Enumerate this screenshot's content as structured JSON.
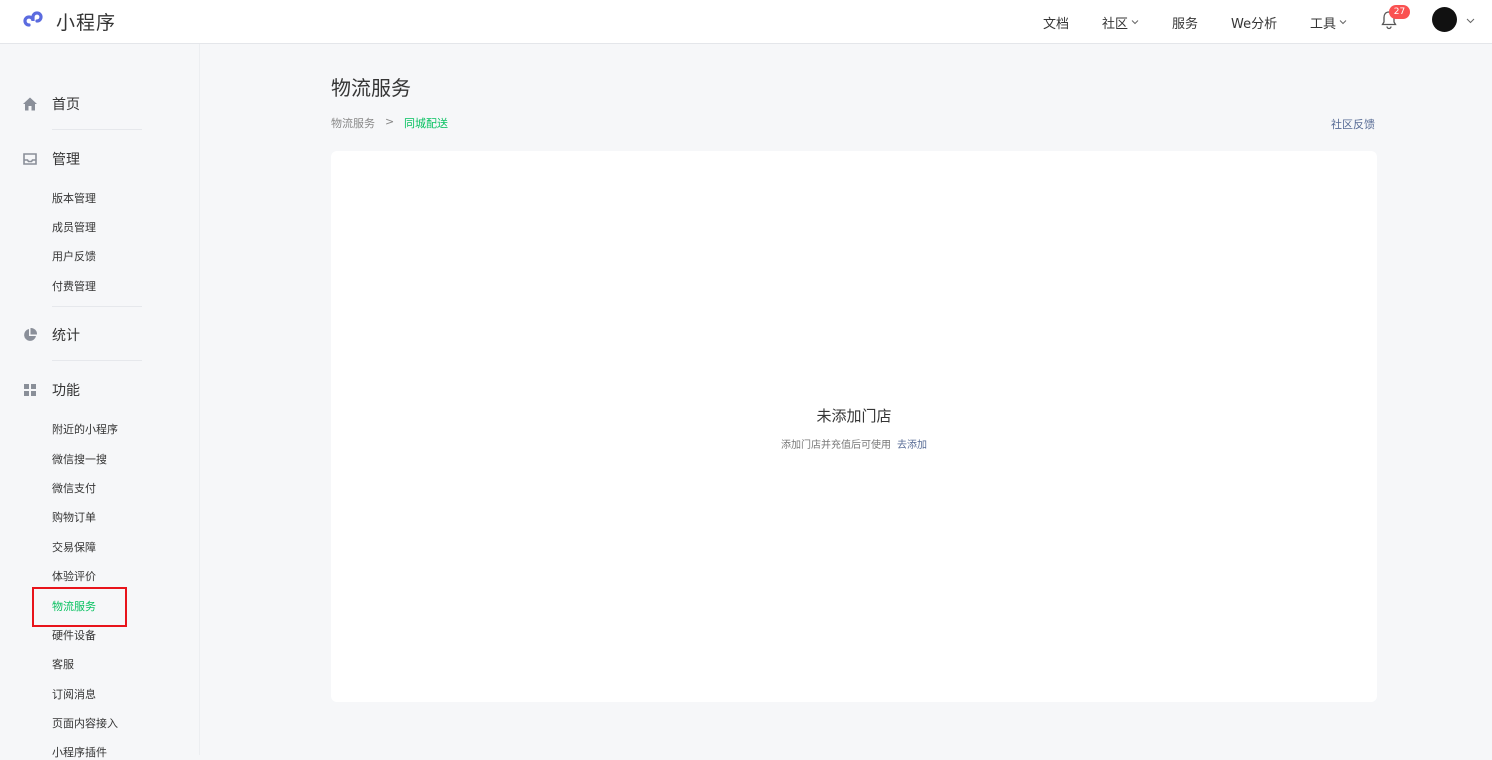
{
  "header": {
    "logo_text": "小程序",
    "nav": {
      "docs": "文档",
      "community": "社区",
      "services": "服务",
      "we_analytics": "We分析",
      "tools": "工具"
    },
    "notification_count": "27"
  },
  "sidebar": {
    "home": "首页",
    "manage": "管理",
    "manage_items": [
      "版本管理",
      "成员管理",
      "用户反馈",
      "付费管理"
    ],
    "stats": "统计",
    "features": "功能",
    "feature_items": [
      "附近的小程序",
      "微信搜一搜",
      "微信支付",
      "购物订单",
      "交易保障",
      "体验评价",
      "物流服务",
      "硬件设备",
      "客服",
      "订阅消息",
      "页面内容接入",
      "小程序插件"
    ]
  },
  "main": {
    "title": "物流服务",
    "breadcrumb": [
      "物流服务",
      "同城配送"
    ],
    "breadcrumb_sep": ">",
    "feedback_link": "社区反馈",
    "empty_title": "未添加门店",
    "empty_desc": "添加门店并充值后可使用",
    "empty_action": "去添加"
  },
  "colors": {
    "accent_green": "#07c160",
    "link_blue": "#576b95",
    "highlight_red": "#e8141b",
    "badge_red": "#fa5151"
  }
}
